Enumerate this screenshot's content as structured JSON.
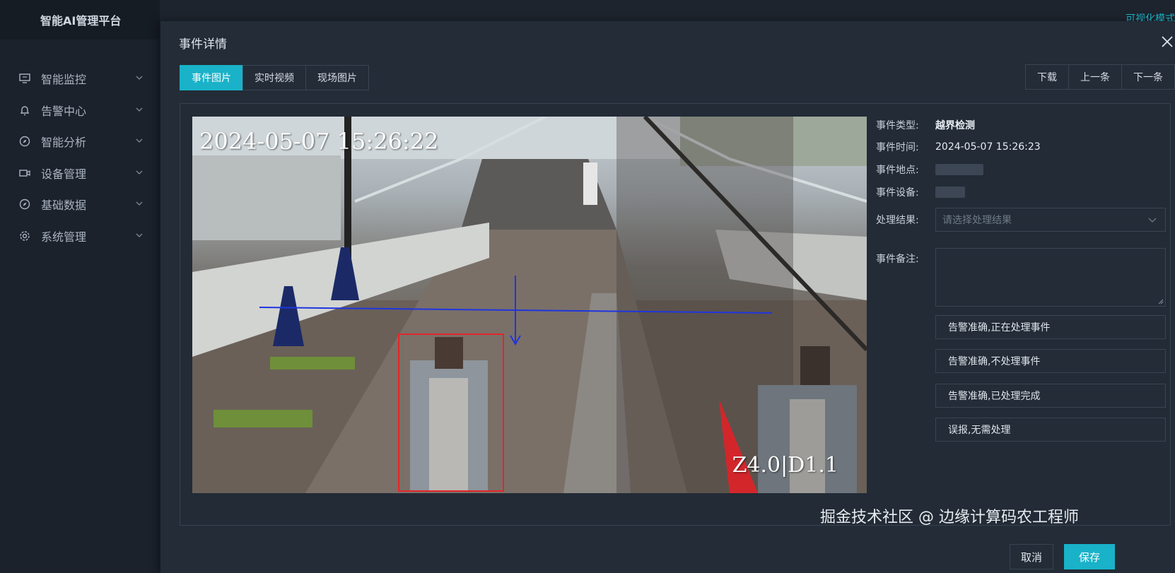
{
  "app": {
    "title": "智能AI管理平台",
    "top_right": "可视化模式"
  },
  "sidebar": {
    "items": [
      {
        "label": "智能监控",
        "icon": "monitor-icon"
      },
      {
        "label": "告警中心",
        "icon": "bell-icon"
      },
      {
        "label": "智能分析",
        "icon": "compass-icon"
      },
      {
        "label": "设备管理",
        "icon": "camera-icon"
      },
      {
        "label": "基础数据",
        "icon": "compass-icon"
      },
      {
        "label": "系统管理",
        "icon": "gear-icon"
      }
    ]
  },
  "modal": {
    "title": "事件详情",
    "tabs": [
      {
        "label": "事件图片",
        "active": true
      },
      {
        "label": "实时视频",
        "active": false
      },
      {
        "label": "现场图片",
        "active": false
      }
    ],
    "nav": {
      "download": "下载",
      "prev": "上一条",
      "next": "下一条"
    },
    "image": {
      "timestamp": "2024-05-07 15:26:22",
      "zoom": "Z4.0|D1.1"
    },
    "details": {
      "type_label": "事件类型:",
      "type_value": "越界检测",
      "time_label": "事件时间:",
      "time_value": "2024-05-07 15:26:23",
      "place_label": "事件地点:",
      "device_label": "事件设备:",
      "result_label": "处理结果:",
      "result_placeholder": "请选择处理结果",
      "note_label": "事件备注:"
    },
    "actions": [
      "告警准确,正在处理事件",
      "告警准确,不处理事件",
      "告警准确,已处理完成",
      "误报,无需处理"
    ],
    "watermark": "掘金技术社区 @ 边缘计算码农工程师",
    "cancel": "取消",
    "save": "保存"
  },
  "colors": {
    "accent": "#19b2c8",
    "background": "#1b222c",
    "panel": "#232c37"
  }
}
